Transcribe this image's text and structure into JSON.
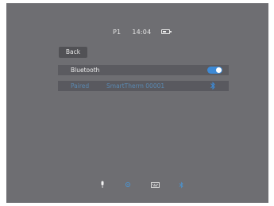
{
  "status_bar": {
    "profile": "P1",
    "time": "14:04",
    "battery_icon": "battery-icon",
    "battery_level": 0.6
  },
  "back_button": {
    "label": "Back"
  },
  "bluetooth_row": {
    "label": "Bluetooth",
    "toggle_on": true,
    "accent_color": "#3d8ad6"
  },
  "paired_row": {
    "status": "Paired",
    "device": "SmartTherm 00001",
    "icon": "bluetooth-icon",
    "text_color": "#5a88b0"
  },
  "bottom_bar": {
    "icons": [
      "microphone-icon",
      "gear-icon",
      "keyboard-icon",
      "bluetooth-icon"
    ]
  }
}
